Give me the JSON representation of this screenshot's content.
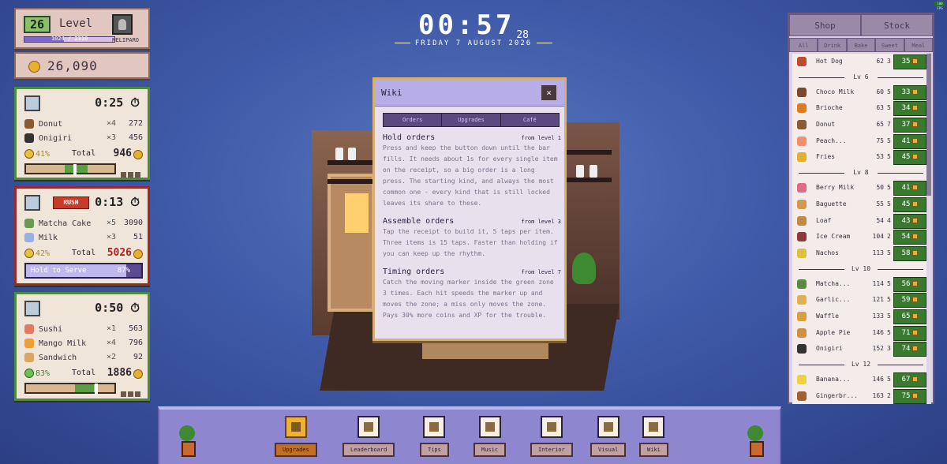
{
  "level": {
    "label": "Level",
    "value": "26",
    "xp": "1024 / 2310",
    "xp_fraction": 0.44,
    "username": "MELIPARO"
  },
  "coins": {
    "value": "26,090"
  },
  "clock": {
    "time": "00:57",
    "seconds": "28",
    "date": "FRIDAY 7 AUGUST 2026"
  },
  "orders": [
    {
      "timer": "0:25",
      "items": [
        {
          "name": "Donut",
          "qty": "×4",
          "price": "272",
          "color": "#8a5a30"
        },
        {
          "name": "Onigiri",
          "qty": "×3",
          "price": "456",
          "color": "#333"
        }
      ],
      "pct": "41%",
      "total_label": "Total",
      "total": "946",
      "zone": [
        0.44,
        0.7
      ],
      "marker": 0.54
    },
    {
      "timer": "0:13",
      "rush": "RUSH",
      "items": [
        {
          "name": "Matcha Cake",
          "qty": "×5",
          "price": "3090",
          "color": "#6a9a50"
        },
        {
          "name": "Milk",
          "qty": "×3",
          "price": "51",
          "color": "#9ab0e0"
        }
      ],
      "pct": "42%",
      "total_label": "Total",
      "total": "5026",
      "hold_label": "Hold to Serve",
      "hold_pct": "87%"
    },
    {
      "timer": "0:50",
      "items": [
        {
          "name": "Sushi",
          "qty": "×1",
          "price": "563",
          "color": "#e07a60"
        },
        {
          "name": "Mango Milk",
          "qty": "×4",
          "price": "796",
          "color": "#f0a030"
        },
        {
          "name": "Sandwich",
          "qty": "×2",
          "price": "92",
          "color": "#d8a860"
        }
      ],
      "pct": "83%",
      "total_label": "Total",
      "total": "1886",
      "zone": [
        0.55,
        0.77
      ],
      "marker": 0.78
    }
  ],
  "wiki": {
    "title": "Wiki",
    "close": "×",
    "tabs": [
      "Orders",
      "Upgrades",
      "Café"
    ],
    "sections": [
      {
        "title": "Hold orders",
        "level": "from level 1",
        "body": "Press and keep the button down until the bar fills. It needs about 1s for every single item on the receipt, so a big order is a long press. The starting kind, and always the most common one - every kind that is still locked leaves its share to these."
      },
      {
        "title": "Assemble orders",
        "level": "from level 3",
        "body": "Tap the receipt to build it, 5 taps per item. Three items is 15 taps. Faster than holding if you can keep up the rhythm."
      },
      {
        "title": "Timing orders",
        "level": "from level 7",
        "body": "Catch the moving marker inside the green zone 3 times. Each hit speeds the marker up and moves the zone; a miss only moves the zone. Pays 30% more coins and XP for the trouble."
      }
    ]
  },
  "shop": {
    "tabs": [
      "Shop",
      "Stock"
    ],
    "categories": [
      "All",
      "Drink",
      "Bake",
      "Sweet",
      "Meal"
    ],
    "groups": [
      {
        "level": "",
        "items": [
          {
            "name": "Hot Dog",
            "price": "62",
            "stock": "3",
            "buy": "35",
            "color": "#c04a30"
          }
        ]
      },
      {
        "level": "Lv 6",
        "items": [
          {
            "name": "Choco Milk",
            "price": "60",
            "stock": "5",
            "buy": "33",
            "color": "#7a4a30"
          },
          {
            "name": "Brioche",
            "price": "63",
            "stock": "5",
            "buy": "34",
            "color": "#e07a20"
          },
          {
            "name": "Donut",
            "price": "65",
            "stock": "7",
            "buy": "37",
            "color": "#8a5a30"
          },
          {
            "name": "Peach...",
            "price": "75",
            "stock": "5",
            "buy": "41",
            "color": "#f09070"
          },
          {
            "name": "Fries",
            "price": "53",
            "stock": "5",
            "buy": "45",
            "color": "#e0b030"
          }
        ]
      },
      {
        "level": "Lv 8",
        "items": [
          {
            "name": "Berry Milk",
            "price": "50",
            "stock": "5",
            "buy": "41",
            "color": "#e06a8a"
          },
          {
            "name": "Baguette",
            "price": "55",
            "stock": "5",
            "buy": "45",
            "color": "#d09a50"
          },
          {
            "name": "Loaf",
            "price": "54",
            "stock": "4",
            "buy": "43",
            "color": "#c08a40"
          },
          {
            "name": "Ice Cream",
            "price": "104",
            "stock": "2",
            "buy": "54",
            "color": "#8a3a3a"
          },
          {
            "name": "Nachos",
            "price": "113",
            "stock": "5",
            "buy": "58",
            "color": "#e0c040"
          }
        ]
      },
      {
        "level": "Lv 10",
        "items": [
          {
            "name": "Matcha...",
            "price": "114",
            "stock": "5",
            "buy": "56",
            "color": "#5a8a40"
          },
          {
            "name": "Garlic...",
            "price": "121",
            "stock": "5",
            "buy": "59",
            "color": "#e0b050"
          },
          {
            "name": "Waffle",
            "price": "133",
            "stock": "5",
            "buy": "65",
            "color": "#d8a040"
          },
          {
            "name": "Apple Pie",
            "price": "146",
            "stock": "5",
            "buy": "71",
            "color": "#d09040"
          },
          {
            "name": "Onigiri",
            "price": "152",
            "stock": "3",
            "buy": "74",
            "color": "#333"
          }
        ]
      },
      {
        "level": "Lv 12",
        "items": [
          {
            "name": "Banana...",
            "price": "146",
            "stock": "5",
            "buy": "67",
            "color": "#f0d040"
          },
          {
            "name": "Gingerbr...",
            "price": "163",
            "stock": "2",
            "buy": "75",
            "color": "#a06030"
          }
        ]
      }
    ]
  },
  "bottom_bar": [
    "Upgrades",
    "Leaderboard",
    "Tips",
    "Music",
    "Interior",
    "Visual",
    "Wiki"
  ],
  "fps": "100 FPS"
}
